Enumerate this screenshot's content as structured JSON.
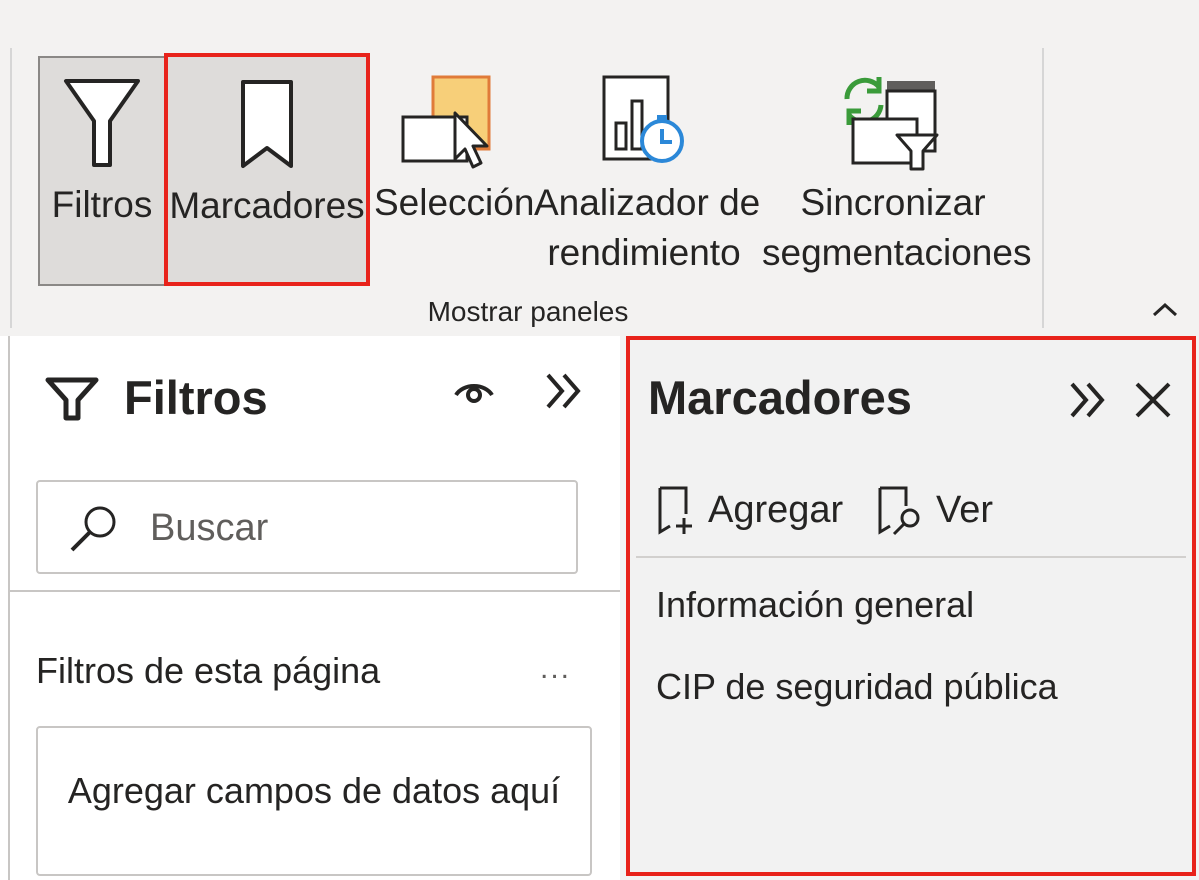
{
  "ribbon": {
    "buttons": [
      {
        "icon": "filter-icon",
        "label": "Filtros",
        "pressed": true
      },
      {
        "icon": "bookmark-icon",
        "label": "Marcadores",
        "pressed": true,
        "highlighted": true
      },
      {
        "icon": "selection-icon",
        "label": "Selección"
      },
      {
        "icon": "performance-analyzer-icon",
        "label_line1": "Analizador de",
        "label_line2": "rendimiento"
      },
      {
        "icon": "sync-slicers-icon",
        "label_line1": "Sincronizar",
        "label_line2": "segmentaciones"
      }
    ],
    "group_label": "Mostrar paneles",
    "collapse_icon": "chevron-up-icon"
  },
  "filters_pane": {
    "title": "Filtros",
    "search_placeholder": "Buscar",
    "section_label": "Filtros de esta página",
    "more_label": "...",
    "drop_zone_label": "Agregar campos de datos aquí",
    "icons": [
      "filter-icon",
      "eye-icon",
      "expand-icon",
      "search-icon"
    ]
  },
  "bookmarks_pane": {
    "title": "Marcadores",
    "add_label": "Agregar",
    "view_label": "Ver",
    "items": [
      "Información general",
      "CIP de seguridad pública"
    ],
    "icons": [
      "expand-icon",
      "close-icon",
      "add-bookmark-icon",
      "view-bookmark-icon"
    ]
  },
  "colors": {
    "highlight": "#e8231b",
    "pressed_bg": "#dedcda",
    "ribbon_bg": "#f3f2f1"
  }
}
